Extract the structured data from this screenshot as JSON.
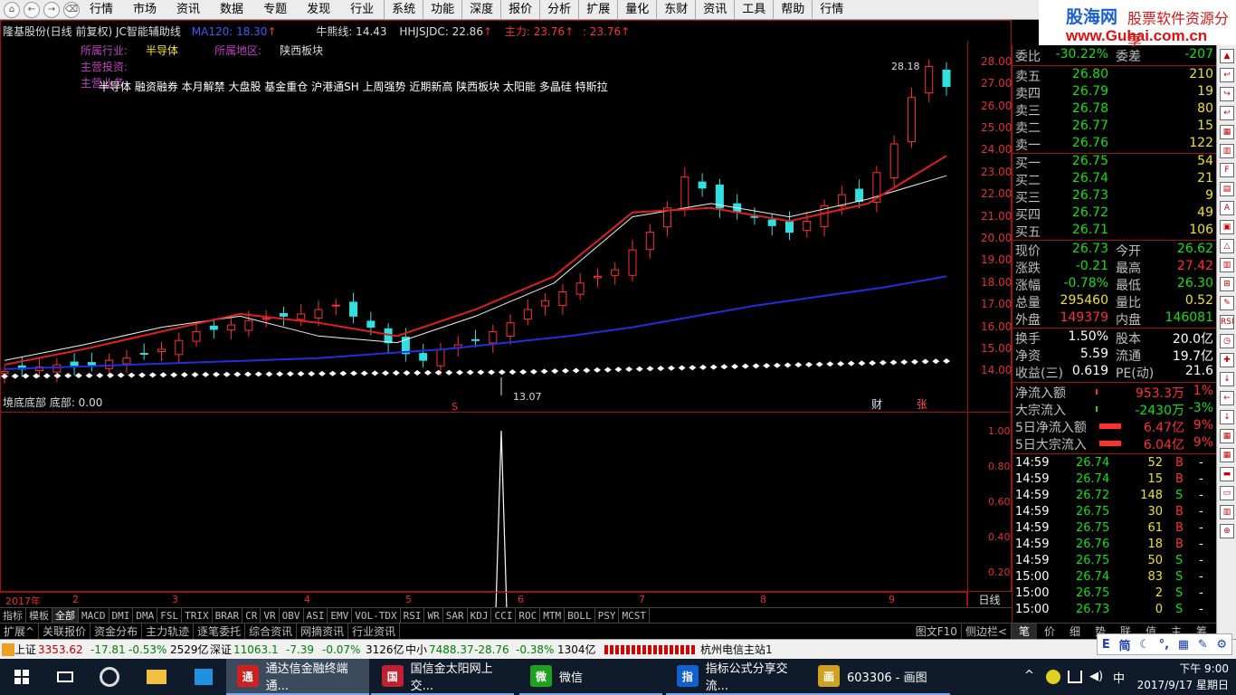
{
  "menubar": {
    "nav": [
      "⌂",
      "←",
      "→",
      "⌫"
    ],
    "items": [
      "行情",
      "市场",
      "资讯",
      "数据",
      "专题",
      "发现",
      "行业",
      "系统",
      "功能",
      "深度",
      "报价",
      "分析",
      "扩展",
      "量化",
      "东财",
      "资讯",
      "工具",
      "帮助",
      "行情"
    ]
  },
  "brand": {
    "name": "股海网",
    "slogan": "股票软件资源分享",
    "url": "www.Guhai.com.cn"
  },
  "chart_header": {
    "title": "隆基股份(日线 前复权) JC智能辅助线",
    "ma120_label": "MA120: 18.30",
    "nengliang": "牛熊线: 14.43",
    "hhjsjdc": "HHJSJDC: 22.86",
    "zhuli": "主力: 23.76",
    "zhuli2": ": 23.76"
  },
  "sector": {
    "industry_label": "所属行业:",
    "industry": "半导体",
    "region_label": "所属地区:",
    "region": "陕西板块",
    "invest_label": "主营投资:",
    "business_label": "主营业务:"
  },
  "tags": "半导体 融资融券 本月解禁 大盘股 基金重仓 沪港通SH 上周强势 近期新高 陕西板块 太阳能 多晶硅 特斯拉",
  "chart_labels": {
    "high_label": "28.18",
    "low_label": "13.07",
    "mark_cai": "财",
    "mark_zhang": "张",
    "mark_s": "S"
  },
  "chart_data": {
    "type": "line",
    "title": "隆基股份(日线 前复权)",
    "price_ticks": [
      28.0,
      27.0,
      26.0,
      25.0,
      24.0,
      23.0,
      22.0,
      21.0,
      20.0,
      19.0,
      18.0,
      17.0,
      16.0,
      15.0,
      14.0
    ],
    "ylim": [
      13.4,
      28.4
    ],
    "x_months": [
      "2017年",
      "2",
      "3",
      "4",
      "5",
      "6",
      "7",
      "8",
      "9"
    ],
    "price_close": [
      14.0,
      14.1,
      14.2,
      14.3,
      14.2,
      14.3,
      14.5,
      14.6,
      14.8,
      15.0,
      15.4,
      15.8,
      15.9,
      16.1,
      16.3,
      16.4,
      16.5,
      16.6,
      16.8,
      17.0,
      16.5,
      16.0,
      15.3,
      14.8,
      14.5,
      15.0,
      15.2,
      15.4,
      15.8,
      16.2,
      16.8,
      17.2,
      17.6,
      18.0,
      18.3,
      18.6,
      19.5,
      20.3,
      21.4,
      22.8,
      22.3,
      21.4,
      21.2,
      21.0,
      20.6,
      20.3,
      20.8,
      21.5,
      22.0,
      21.7,
      23.0,
      24.3,
      26.4,
      27.8,
      26.9
    ],
    "high": 28.18,
    "low": 13.07,
    "series": [
      {
        "name": "MA120",
        "values": [
          14.1,
          14.2,
          14.3,
          14.4,
          14.5,
          14.6,
          14.8,
          15.0,
          15.3,
          15.6,
          16.0,
          16.5,
          17.0,
          17.4,
          17.8,
          18.3
        ]
      },
      {
        "name": "牛熊线",
        "values": [
          14.43,
          14.43,
          14.43,
          14.43,
          14.43,
          14.43,
          14.43,
          14.43
        ]
      },
      {
        "name": "HHJSJDC",
        "values": [
          14.5,
          15.2,
          16.0,
          16.5,
          15.6,
          15.3,
          16.5,
          18.0,
          21.0,
          21.6,
          21.0,
          21.8,
          22.86
        ]
      },
      {
        "name": "主力",
        "values": [
          14.3,
          15.0,
          15.8,
          16.6,
          16.2,
          15.6,
          16.8,
          18.3,
          21.2,
          21.4,
          20.8,
          21.6,
          23.76
        ]
      }
    ]
  },
  "sub_chart": {
    "title": "境底底部 底部: 0.00",
    "ticks": [
      "1.00",
      "0.80",
      "0.60",
      "0.40",
      "0.20"
    ],
    "spike_value": 1.0
  },
  "date_axis": {
    "labels": [
      "2017年",
      "2",
      "3",
      "4",
      "5",
      "6",
      "7",
      "8",
      "9"
    ]
  },
  "daily_label": "日线",
  "indicator_tabs": [
    "指标",
    "模板",
    "全部",
    "MACD",
    "DMI",
    "DMA",
    "FSL",
    "TRIX",
    "BRAR",
    "CR",
    "VR",
    "OBV",
    "ASI",
    "EMV",
    "VOL-TDX",
    "RSI",
    "WR",
    "SAR",
    "KDJ",
    "CCI",
    "ROC",
    "MTM",
    "BOLL",
    "PSY",
    "MCST"
  ],
  "bottom_tabs": [
    "扩展^",
    "关联报价",
    "资金分布",
    "主力轨迹",
    "逐笔委托",
    "综合资讯",
    "网摘资讯",
    "行业资讯"
  ],
  "bottom_right": [
    "图文F10",
    "侧边栏<"
  ],
  "quote": {
    "weibi_label": "委比",
    "weibi": "-30.22%",
    "weicha_label": "委差",
    "weicha": "-207",
    "sell": [
      {
        "label": "卖五",
        "price": "26.80",
        "vol": "210"
      },
      {
        "label": "卖四",
        "price": "26.79",
        "vol": "19"
      },
      {
        "label": "卖三",
        "price": "26.78",
        "vol": "80"
      },
      {
        "label": "卖二",
        "price": "26.77",
        "vol": "15"
      },
      {
        "label": "卖一",
        "price": "26.76",
        "vol": "122"
      }
    ],
    "buy": [
      {
        "label": "买一",
        "price": "26.75",
        "vol": "54"
      },
      {
        "label": "买二",
        "price": "26.74",
        "vol": "21"
      },
      {
        "label": "买三",
        "price": "26.73",
        "vol": "9"
      },
      {
        "label": "买四",
        "price": "26.72",
        "vol": "49"
      },
      {
        "label": "买五",
        "price": "26.71",
        "vol": "106"
      }
    ],
    "stats": [
      {
        "l1": "现价",
        "v1": "26.73",
        "c1": "green",
        "l2": "今开",
        "v2": "26.62",
        "c2": "green"
      },
      {
        "l1": "涨跌",
        "v1": "-0.21",
        "c1": "green",
        "l2": "最高",
        "v2": "27.42",
        "c2": "red"
      },
      {
        "l1": "涨幅",
        "v1": "-0.78%",
        "c1": "green",
        "l2": "最低",
        "v2": "26.30",
        "c2": "green"
      },
      {
        "l1": "总量",
        "v1": "295460",
        "c1": "yellow",
        "l2": "量比",
        "v2": "0.52",
        "c2": "yellow"
      },
      {
        "l1": "外盘",
        "v1": "149379",
        "c1": "red",
        "l2": "内盘",
        "v2": "146081",
        "c2": "green"
      },
      {
        "l1": "换手",
        "v1": "1.50%",
        "c1": "white",
        "l2": "股本",
        "v2": "20.0亿",
        "c2": "white"
      },
      {
        "l1": "净资",
        "v1": "5.59",
        "c1": "white",
        "l2": "流通",
        "v2": "19.7亿",
        "c2": "white"
      },
      {
        "l1": "收益(三)",
        "v1": "0.619",
        "c1": "white",
        "l2": "PE(动)",
        "v2": "21.6",
        "c2": "white"
      }
    ],
    "flows": [
      {
        "label": "净流入额",
        "value": "953.3万",
        "pct": "1%",
        "c": "red"
      },
      {
        "label": "大宗流入",
        "value": "-2430万",
        "pct": "-3%",
        "c": "green"
      },
      {
        "label": "5日净流入额",
        "value": "6.47亿",
        "pct": "9%",
        "c": "red"
      },
      {
        "label": "5日大宗流入",
        "value": "6.04亿",
        "pct": "9%",
        "c": "red"
      }
    ],
    "ticks": [
      {
        "t": "14:59",
        "p": "26.74",
        "v": "52",
        "s": "B"
      },
      {
        "t": "14:59",
        "p": "26.74",
        "v": "15",
        "s": "B"
      },
      {
        "t": "14:59",
        "p": "26.72",
        "v": "148",
        "s": "S"
      },
      {
        "t": "14:59",
        "p": "26.75",
        "v": "30",
        "s": "B"
      },
      {
        "t": "14:59",
        "p": "26.75",
        "v": "61",
        "s": "B"
      },
      {
        "t": "14:59",
        "p": "26.76",
        "v": "18",
        "s": "B"
      },
      {
        "t": "14:59",
        "p": "26.75",
        "v": "50",
        "s": "S"
      },
      {
        "t": "15:00",
        "p": "26.74",
        "v": "83",
        "s": "S"
      },
      {
        "t": "15:00",
        "p": "26.75",
        "v": "2",
        "s": "S"
      },
      {
        "t": "15:00",
        "p": "26.73",
        "v": "0",
        "s": "S"
      }
    ]
  },
  "rb_tabs": [
    "笔",
    "价",
    "细",
    "势",
    "联",
    "值",
    "主",
    "筹"
  ],
  "status": {
    "sh_label": "上证",
    "sh_val": "3353.62",
    "sh_chg": "-17.81",
    "sh_pct": "-0.53%",
    "sh_amt": "2529亿",
    "sz_label": "深证",
    "sz_val": "11063.1",
    "sz_chg": "-7.39",
    "sz_pct": "-0.07%",
    "sz_amt": "3126亿",
    "zx_label": "中小",
    "zx_val": "7488.37",
    "zx_chg": "-28.76",
    "zx_pct": "-0.38%",
    "zx_amt": "1304亿",
    "server": "杭州电信主站1"
  },
  "ime": [
    "E",
    "简",
    "☾",
    "°,",
    "▦",
    "✎",
    "⚙"
  ],
  "taskbar": {
    "items": [
      {
        "label": "通达信金融终端通...",
        "color": "#d02020",
        "icon": "通"
      },
      {
        "label": "国信金太阳网上交...",
        "color": "#c02030",
        "icon": "国"
      },
      {
        "label": "微信",
        "color": "#20a020",
        "icon": "微"
      },
      {
        "label": "指标公式分享交流...",
        "color": "#1060d0",
        "icon": "指"
      },
      {
        "label": "603306 - 画图",
        "color": "#d0a020",
        "icon": "画"
      }
    ],
    "time": "下午 9:00",
    "date": "2017/9/17 星期日"
  }
}
